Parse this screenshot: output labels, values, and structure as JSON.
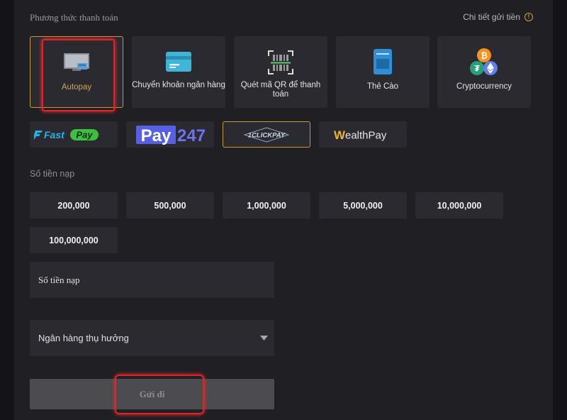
{
  "header": {
    "title": "Phương thức thanh toán",
    "details_link": "Chi tiết gửi tiền",
    "details_icon": "info-icon"
  },
  "methods": [
    {
      "label": "Autopay",
      "icon": "monitor-icon",
      "selected": true
    },
    {
      "label": "Chuyển khoản ngân hàng",
      "icon": "card-icon",
      "selected": false
    },
    {
      "label": "Quét mã QR để thanh toán",
      "icon": "qr-scan-icon",
      "selected": false
    },
    {
      "label": "Thẻ Cào",
      "icon": "scratch-card-icon",
      "selected": false
    },
    {
      "label": "Cryptocurrency",
      "icon": "crypto-coins-icon",
      "selected": false
    }
  ],
  "providers": [
    {
      "label": "FastPay",
      "prefix": "Fast",
      "suffix": "Pay",
      "selected": false
    },
    {
      "label": "Pay247",
      "prefix": "Pay",
      "suffix": "247",
      "selected": false
    },
    {
      "label": "1CLICKPAY",
      "selected": true
    },
    {
      "label": "WealthPay",
      "prefix": "W",
      "suffix": "ealthPay",
      "selected": false
    }
  ],
  "amount_section": {
    "label": "Số tiền nạp"
  },
  "amounts": [
    "200,000",
    "500,000",
    "1,000,000",
    "5,000,000",
    "10,000,000",
    "100,000,000"
  ],
  "amount_input": {
    "placeholder": "Số tiền nạp"
  },
  "bank_select": {
    "value": "Ngân hàng thụ hưởng"
  },
  "submit": {
    "label": "Gửi đi"
  },
  "colors": {
    "background": "#1f1f24",
    "tile": "#2a2a30",
    "accent_gold": "#c79a3c",
    "highlight_red": "#e0242b"
  }
}
